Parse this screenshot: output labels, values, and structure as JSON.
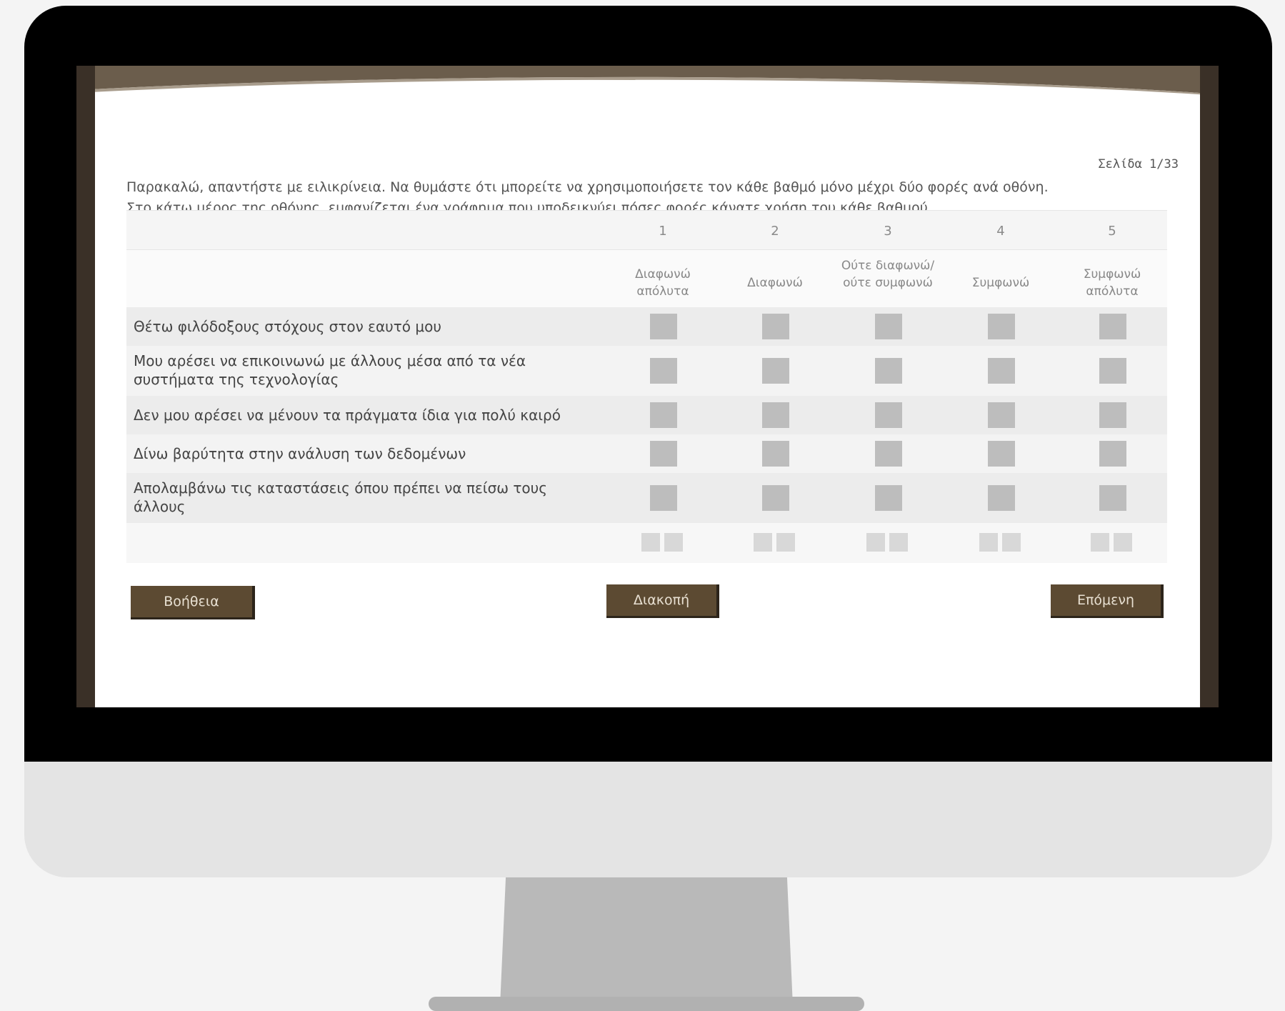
{
  "page": {
    "indicator": "Σελίδα 1/33"
  },
  "instructions": {
    "line1": "Παρακαλώ, απαντήστε με ειλικρίνεια. Να θυμάστε ότι μπορείτε να χρησιμοποιήσετε τον κάθε βαθμό μόνο μέχρι δύο φορές ανά οθόνη.",
    "line2": "Στο κάτω μέρος της οθόνης, εμφανίζεται ένα γράφημα που υποδεικνύει πόσες φορές κάνατε χρήση του κάθε βαθμού."
  },
  "scale": {
    "numbers": [
      "1",
      "2",
      "3",
      "4",
      "5"
    ],
    "labels": [
      "Διαφωνώ απόλυτα",
      "Διαφωνώ",
      "Ούτε διαφωνώ/ούτε συμφωνώ",
      "Συμφωνώ",
      "Συμφωνώ απόλυτα"
    ]
  },
  "questions": [
    {
      "text": "Θέτω φιλόδοξους στόχους στον εαυτό μου"
    },
    {
      "text": "Μου αρέσει να επικοινωνώ με άλλους μέσα από τα νέα συστήματα της τεχνολογίας"
    },
    {
      "text": "Δεν μου αρέσει να μένουν τα πράγματα ίδια για πολύ καιρό"
    },
    {
      "text": "Δίνω βαρύτητα στην ανάλυση των δεδομένων"
    },
    {
      "text": "Απολαμβάνω τις καταστάσεις όπου πρέπει να πείσω τους άλλους"
    }
  ],
  "buttons": {
    "help": "Βοήθεια",
    "pause": "Διακοπή",
    "next": "Επόμενη"
  },
  "colors": {
    "button_bg": "#5c4a32",
    "checkbox": "#bdbdbd",
    "header_band": "#6b5d4c"
  }
}
